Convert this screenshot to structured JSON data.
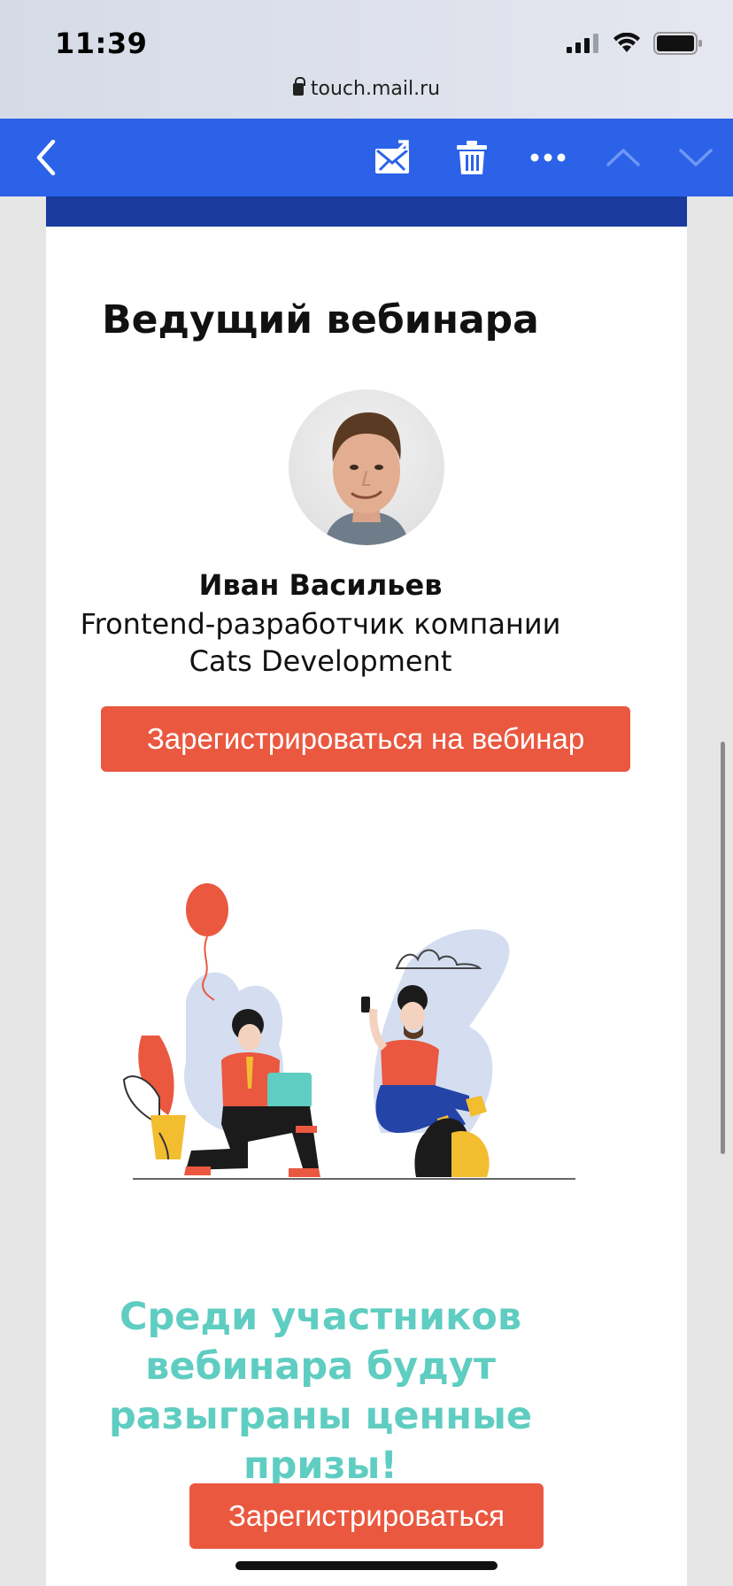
{
  "status_bar": {
    "time": "11:39"
  },
  "browser": {
    "url": "touch.mail.ru"
  },
  "toolbar": {
    "icons": [
      "back-icon",
      "mark-unread-icon",
      "trash-icon",
      "more-icon",
      "prev-message-icon",
      "next-message-icon"
    ],
    "color": "#2b62e8"
  },
  "email": {
    "presenter_heading": "Ведущий вебинара",
    "presenter_name": "Иван Васильев",
    "presenter_role": "Frontend-разработчик компании Cats Development",
    "register_webinar_label": "Зарегистрироваться на вебинар",
    "prize_text": "Среди участников вебинара будут разыграны ценные призы!",
    "register_label": "Зарегистрироваться",
    "accent_color": "#ea5840",
    "prize_color": "#5fcdc1",
    "band_color": "#1a3a9e"
  }
}
